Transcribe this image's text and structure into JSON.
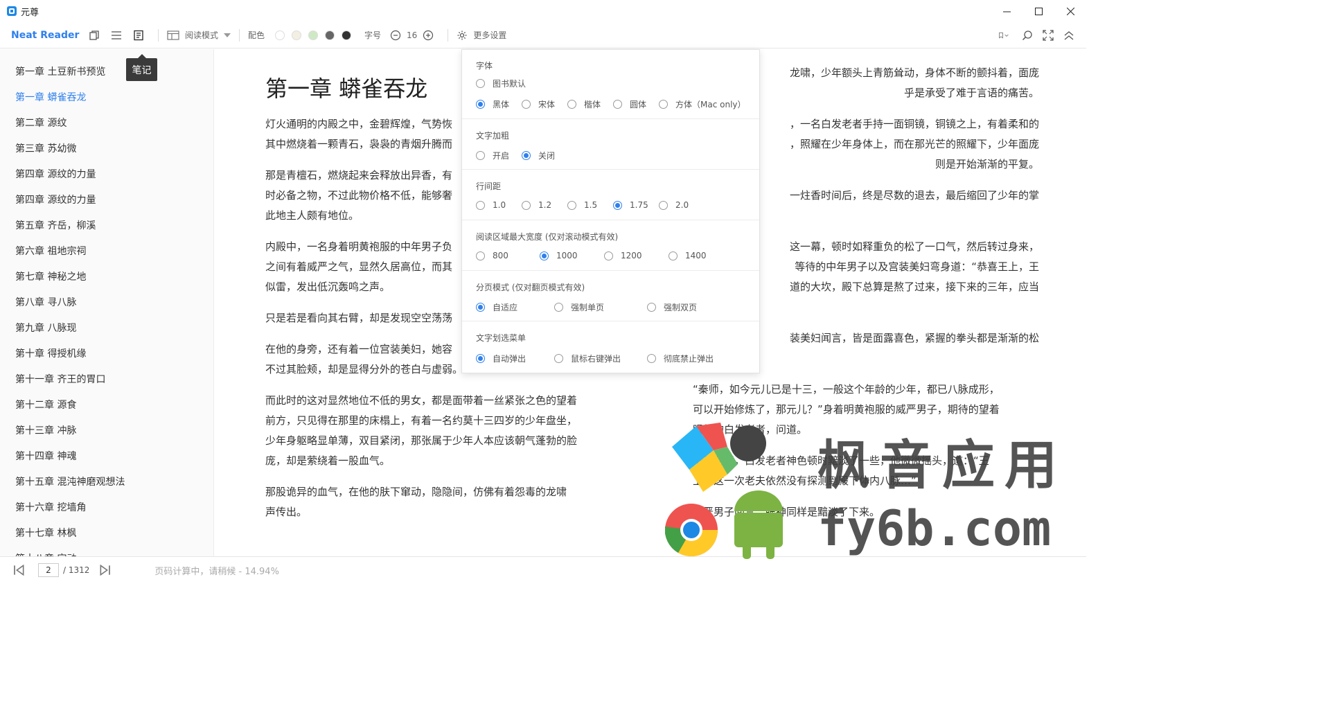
{
  "window": {
    "title": "元尊"
  },
  "toolbar": {
    "brand": "Neat Reader",
    "reading_mode": "阅读模式",
    "color_label": "配色",
    "colors": [
      "#ffffff",
      "#f3efe3",
      "#cfe9c4",
      "#666666",
      "#333333"
    ],
    "fontsize_label": "字号",
    "fontsize_value": "16",
    "more_settings": "更多设置"
  },
  "tooltip": {
    "text": "笔记"
  },
  "toc": {
    "items": [
      "第一章 土豆新书预览",
      "第一章 蟒雀吞龙",
      "第二章 源纹",
      "第三章 苏幼微",
      "第四章 源纹的力量",
      "第四章 源纹的力量",
      "第五章 齐岳，柳溪",
      "第六章 祖地宗祠",
      "第七章 神秘之地",
      "第八章 寻八脉",
      "第九章 八脉现",
      "第十章 得授机缘",
      "第十一章 齐王的胃口",
      "第十二章 源食",
      "第十三章 冲脉",
      "第十四章 神魂",
      "第十五章 混沌神磨观想法",
      "第十六章 挖墙角",
      "第十七章 林枫",
      "第十八章 定动"
    ],
    "active_index": 1
  },
  "content": {
    "chapter_title": "第一章 蟒雀吞龙",
    "left": [
      "灯火通明的内殿之中，金碧辉煌，气势恢",
      "其中燃烧着一颗青石，袅袅的青烟升腾而",
      "那是青檀石，燃烧起来会释放出异香，有",
      "时必备之物，不过此物价格不低，能够奢",
      "此地主人颇有地位。",
      "内殿中，一名身着明黄袍服的中年男子负",
      "之间有着威严之气，显然久居高位，而其",
      "似雷，发出低沉轰鸣之声。",
      "只是若是看向其右臂，却是发现空空荡荡",
      "在他的身旁，还有着一位宫装美妇，她容",
      "不过其脸颊，却是显得分外的苍白与虚弱。",
      "而此时的这对显然地位不低的男女，都是面带着一丝紧张之色的望着",
      "前方，只见得在那里的床榻上，有着一名约莫十三四岁的少年盘坐，",
      "少年身躯略显单薄，双目紧闭，那张属于少年人本应该朝气蓬勃的脸",
      "庞，却是萦绕着一股血气。",
      "那股诡异的血气，在他的肤下窜动，隐隐间，仿佛有着怨毒的龙啸",
      "声传出。"
    ],
    "right": [
      "龙啸，少年额头上青筋耸动，身体不断的颤抖着，面庞",
      "乎是承受了难于言语的痛苦。",
      "，一名白发老者手持一面铜镜，铜镜之上，有着柔和的",
      "，照耀在少年身体上，而在那光芒的照耀下，少年面庞",
      "则是开始渐渐的平复。",
      "一炷香时间后，终是尽数的退去，最后缩回了少年的掌",
      "这一幕，顿时如释重负的松了一口气，然后转过身来，",
      "等待的中年男子以及宫装美妇弯身道：“恭喜王上，王",
      "道的大坎，殿下总算是熬了过来，接下来的三年，应当",
      "装美妇闻言，皆是面露喜色，紧握的拳头都是渐渐的松",
      "“秦师，如今元儿已是十三，一般这个年龄的少年，都已八脉成形，",
      "可以开始修炼了，那元儿？”身着明黄袍服的威严男子，期待的望着",
      "眼前的白发老者，问道。",
      "听到此问，白发老者神色顿时黯淡了一些，他微微摇头，道：“王",
      "上，这一次老夫依然没有探测到殿下体内八脉…”",
      "威严男子闻言，眼神同样是黯淡了下来。"
    ]
  },
  "settings": {
    "font": {
      "title": "字体",
      "options": [
        "图书默认",
        "黑体",
        "宋体",
        "楷体",
        "圆体",
        "方体（Mac only）"
      ],
      "selected": "黑体"
    },
    "bold": {
      "title": "文字加粗",
      "options": [
        "开启",
        "关闭"
      ],
      "selected": "关闭"
    },
    "line_height": {
      "title": "行间距",
      "options": [
        "1.0",
        "1.2",
        "1.5",
        "1.75",
        "2.0"
      ],
      "selected": "1.75"
    },
    "max_width": {
      "title": "阅读区域最大宽度 (仅对滚动模式有效)",
      "options": [
        "800",
        "1000",
        "1200",
        "1400"
      ],
      "selected": "1000"
    },
    "paging": {
      "title": "分页模式 (仅对翻页模式有效)",
      "options": [
        "自适应",
        "强制单页",
        "强制双页"
      ],
      "selected": "自适应"
    },
    "selection_menu": {
      "title": "文字划选菜单",
      "options": [
        "自动弹出",
        "鼠标右键弹出",
        "彻底禁止弹出"
      ],
      "selected": "自动弹出"
    }
  },
  "pager": {
    "current": "2",
    "total": "/ 1312",
    "progress": "页码计算中，请稍候 - 14.94%"
  },
  "watermark": {
    "text": "枫音应用",
    "url": "fy6b.com"
  }
}
